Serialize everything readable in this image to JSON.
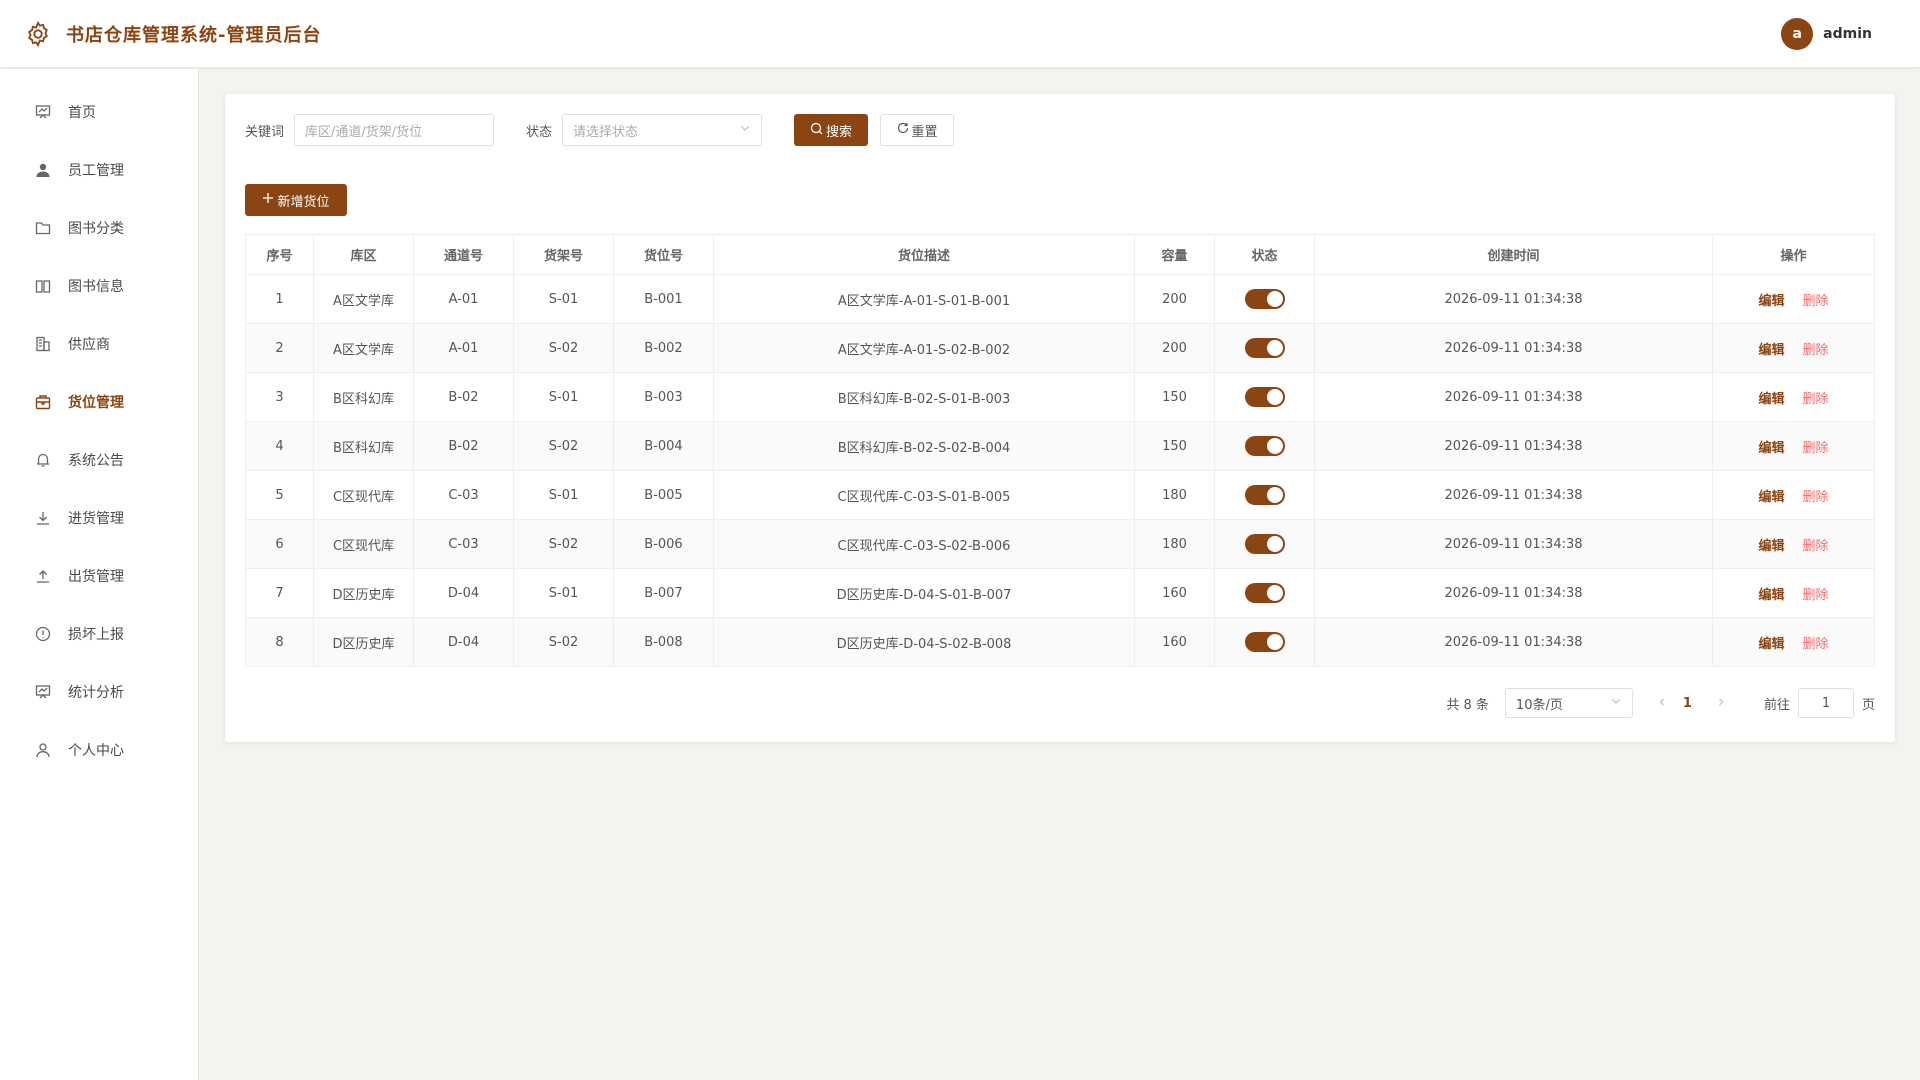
{
  "header": {
    "title": "书店仓库管理系统-管理员后台",
    "avatar_letter": "a",
    "username": "admin"
  },
  "sidebar": {
    "items": [
      {
        "label": "首页",
        "icon": "dashboard-icon"
      },
      {
        "label": "员工管理",
        "icon": "user-icon"
      },
      {
        "label": "图书分类",
        "icon": "folder-icon"
      },
      {
        "label": "图书信息",
        "icon": "book-icon"
      },
      {
        "label": "供应商",
        "icon": "building-icon"
      },
      {
        "label": "货位管理",
        "icon": "box-icon",
        "active": true
      },
      {
        "label": "系统公告",
        "icon": "bell-icon"
      },
      {
        "label": "进货管理",
        "icon": "download-icon"
      },
      {
        "label": "出货管理",
        "icon": "upload-icon"
      },
      {
        "label": "损坏上报",
        "icon": "warning-icon"
      },
      {
        "label": "统计分析",
        "icon": "chart-icon"
      },
      {
        "label": "个人中心",
        "icon": "user-outline-icon"
      }
    ]
  },
  "filters": {
    "keyword_label": "关键词",
    "keyword_placeholder": "库区/通道/货架/货位",
    "status_label": "状态",
    "status_placeholder": "请选择状态",
    "search_label": "搜索",
    "reset_label": "重置"
  },
  "add_button_label": "新增货位",
  "table": {
    "columns": [
      "序号",
      "库区",
      "通道号",
      "货架号",
      "货位号",
      "货位描述",
      "容量",
      "状态",
      "创建时间",
      "操作"
    ],
    "edit_label": "编辑",
    "delete_label": "删除",
    "rows": [
      {
        "idx": "1",
        "zone": "A区文学库",
        "aisle": "A-01",
        "shelf": "S-01",
        "slot": "B-001",
        "desc": "A区文学库-A-01-S-01-B-001",
        "capacity": "200",
        "status": true,
        "created": "2026-09-11 01:34:38"
      },
      {
        "idx": "2",
        "zone": "A区文学库",
        "aisle": "A-01",
        "shelf": "S-02",
        "slot": "B-002",
        "desc": "A区文学库-A-01-S-02-B-002",
        "capacity": "200",
        "status": true,
        "created": "2026-09-11 01:34:38"
      },
      {
        "idx": "3",
        "zone": "B区科幻库",
        "aisle": "B-02",
        "shelf": "S-01",
        "slot": "B-003",
        "desc": "B区科幻库-B-02-S-01-B-003",
        "capacity": "150",
        "status": true,
        "created": "2026-09-11 01:34:38"
      },
      {
        "idx": "4",
        "zone": "B区科幻库",
        "aisle": "B-02",
        "shelf": "S-02",
        "slot": "B-004",
        "desc": "B区科幻库-B-02-S-02-B-004",
        "capacity": "150",
        "status": true,
        "created": "2026-09-11 01:34:38"
      },
      {
        "idx": "5",
        "zone": "C区现代库",
        "aisle": "C-03",
        "shelf": "S-01",
        "slot": "B-005",
        "desc": "C区现代库-C-03-S-01-B-005",
        "capacity": "180",
        "status": true,
        "created": "2026-09-11 01:34:38"
      },
      {
        "idx": "6",
        "zone": "C区现代库",
        "aisle": "C-03",
        "shelf": "S-02",
        "slot": "B-006",
        "desc": "C区现代库-C-03-S-02-B-006",
        "capacity": "180",
        "status": true,
        "created": "2026-09-11 01:34:38"
      },
      {
        "idx": "7",
        "zone": "D区历史库",
        "aisle": "D-04",
        "shelf": "S-01",
        "slot": "B-007",
        "desc": "D区历史库-D-04-S-01-B-007",
        "capacity": "160",
        "status": true,
        "created": "2026-09-11 01:34:38"
      },
      {
        "idx": "8",
        "zone": "D区历史库",
        "aisle": "D-04",
        "shelf": "S-02",
        "slot": "B-008",
        "desc": "D区历史库-D-04-S-02-B-008",
        "capacity": "160",
        "status": true,
        "created": "2026-09-11 01:34:38"
      }
    ]
  },
  "pagination": {
    "total_text": "共 8 条",
    "page_size": "10条/页",
    "current_page": "1",
    "goto_label": "前往",
    "goto_value": "1",
    "page_suffix": "页"
  },
  "colors": {
    "accent": "#8b4513",
    "danger": "#f56c6c",
    "background": "#f5f3f0"
  }
}
